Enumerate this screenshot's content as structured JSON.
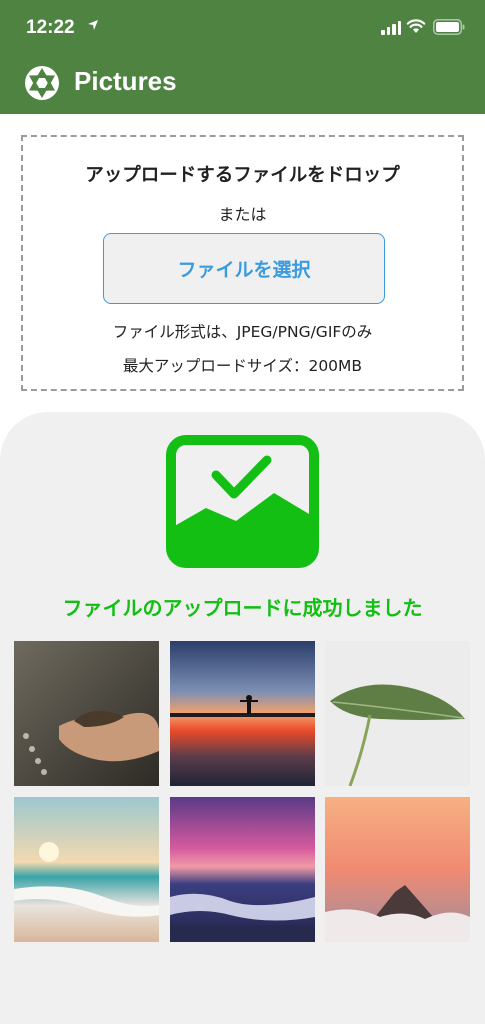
{
  "status_bar": {
    "time": "12:22"
  },
  "header": {
    "title": "Pictures",
    "color": "#4e8342"
  },
  "drop_zone": {
    "title": "アップロードするファイルをドロップ",
    "or_text": "または",
    "select_button": "ファイルを選択",
    "formats_text": "ファイル形式は、JPEG/PNG/GIFのみ",
    "max_size_text": "最大アップロードサイズ：200MB"
  },
  "result": {
    "message": "ファイルのアップロードに成功しました",
    "accent_color": "#12bf12",
    "images": [
      {
        "icon": "hands-holding-soil-image"
      },
      {
        "icon": "person-at-sunset-image"
      },
      {
        "icon": "green-leaf-image"
      },
      {
        "icon": "beach-sunrise-image"
      },
      {
        "icon": "ocean-purple-sky-image"
      },
      {
        "icon": "mountain-peak-clouds-image"
      }
    ]
  }
}
